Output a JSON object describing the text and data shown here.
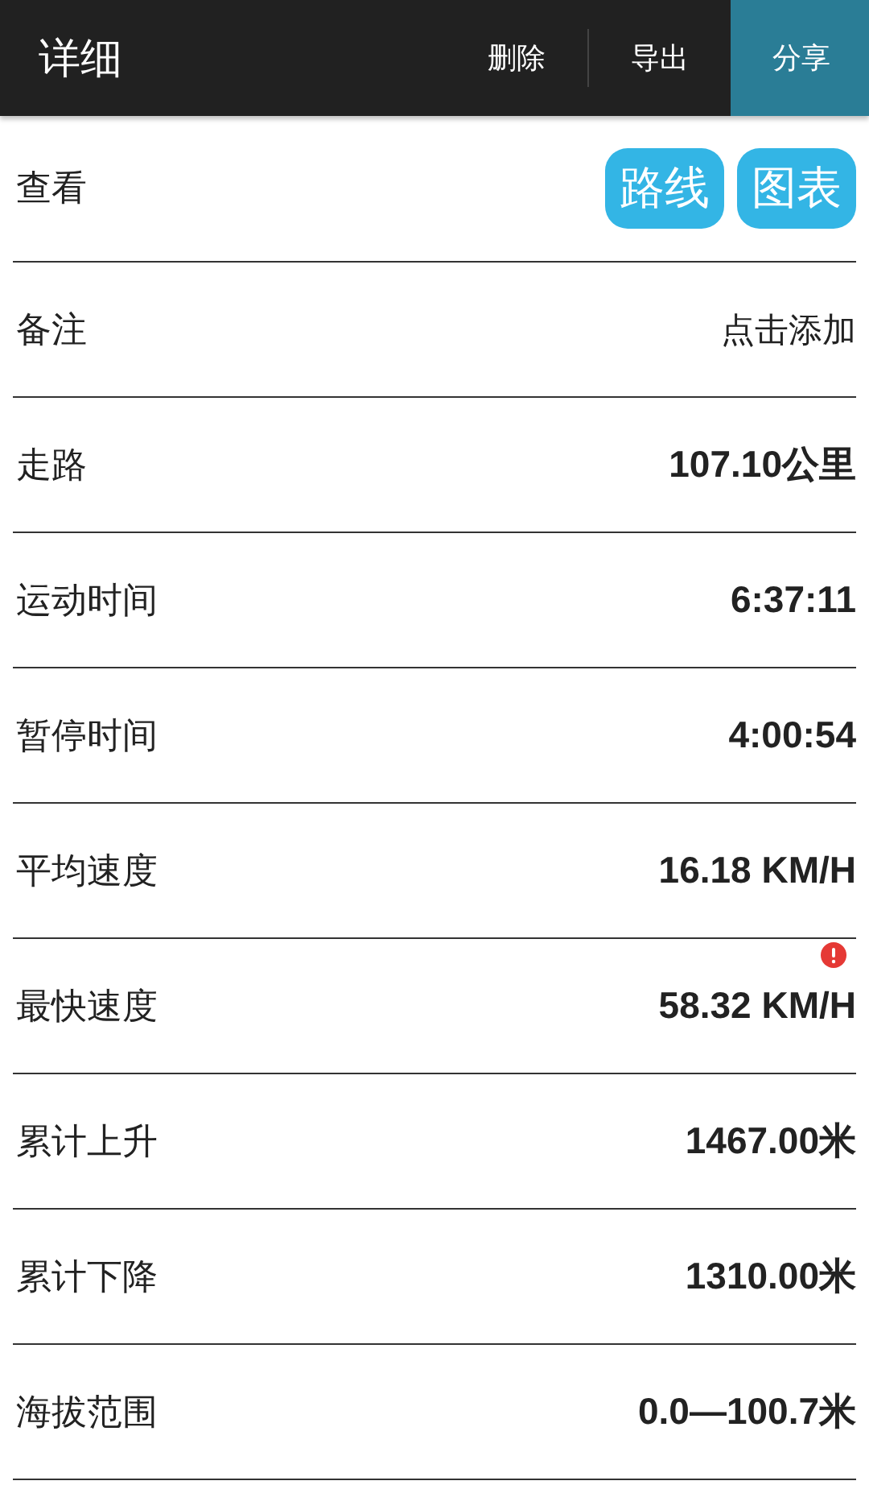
{
  "header": {
    "title": "详细",
    "actions": [
      {
        "label": "删除",
        "selected": false
      },
      {
        "label": "导出",
        "selected": false
      },
      {
        "label": "分享",
        "selected": true
      }
    ]
  },
  "view": {
    "label": "查看",
    "buttons": [
      "路线",
      "图表"
    ]
  },
  "rows": [
    {
      "label": "备注",
      "value": "点击添加",
      "kind": "link",
      "alert": false
    },
    {
      "label": "走路",
      "value": "107.10公里",
      "kind": "stat",
      "alert": false
    },
    {
      "label": "运动时间",
      "value": "6:37:11",
      "kind": "stat",
      "alert": false
    },
    {
      "label": "暂停时间",
      "value": "4:00:54",
      "kind": "stat",
      "alert": false
    },
    {
      "label": "平均速度",
      "value": "16.18 KM/H",
      "kind": "stat",
      "alert": false
    },
    {
      "label": "最快速度",
      "value": "58.32 KM/H",
      "kind": "stat",
      "alert": true
    },
    {
      "label": "累计上升",
      "value": "1467.00米",
      "kind": "stat",
      "alert": false
    },
    {
      "label": "累计下降",
      "value": "1310.00米",
      "kind": "stat",
      "alert": false
    },
    {
      "label": "海拔范围",
      "value": "0.0—100.7米",
      "kind": "stat",
      "alert": false
    }
  ]
}
